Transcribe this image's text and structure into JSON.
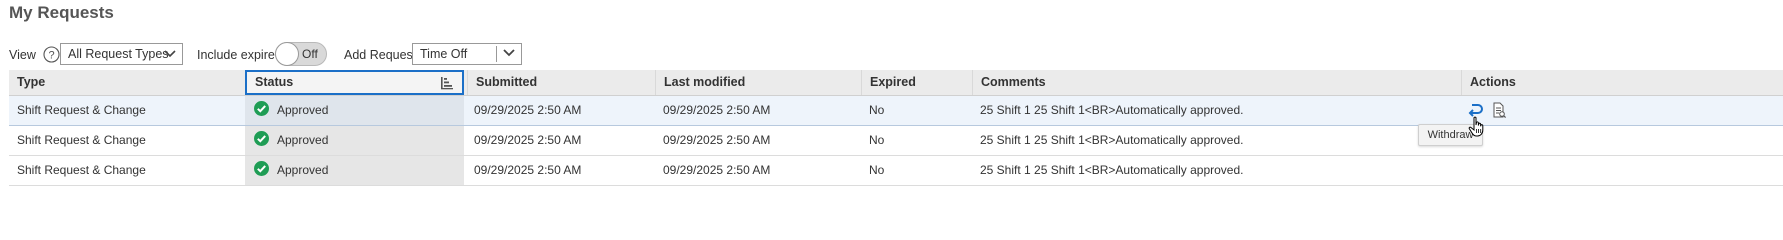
{
  "page": {
    "title": "My Requests"
  },
  "toolbar": {
    "view_label": "View",
    "view_select_value": "All Request Types",
    "include_expired_label": "Include expired",
    "include_expired_toggle": "Off",
    "add_request_label": "Add Request",
    "add_request_value": "Time Off"
  },
  "table": {
    "columns": [
      "Type",
      "Status",
      "Submitted",
      "Last modified",
      "Expired",
      "Comments",
      "Actions"
    ],
    "rows": [
      {
        "type": "Shift Request & Change",
        "status": "Approved",
        "submitted": "09/29/2025 2:50 AM",
        "last_modified": "09/29/2025 2:50 AM",
        "expired": "No",
        "comments": "25 Shift 1 25 Shift 1<BR>Automatically approved."
      },
      {
        "type": "Shift Request & Change",
        "status": "Approved",
        "submitted": "09/29/2025 2:50 AM",
        "last_modified": "09/29/2025 2:50 AM",
        "expired": "No",
        "comments": "25 Shift 1 25 Shift 1<BR>Automatically approved."
      },
      {
        "type": "Shift Request & Change",
        "status": "Approved",
        "submitted": "09/29/2025 2:50 AM",
        "last_modified": "09/29/2025 2:50 AM",
        "expired": "No",
        "comments": "25 Shift 1 25 Shift 1<BR>Automatically approved."
      }
    ]
  },
  "tooltip": {
    "text": "Withdraw"
  },
  "colors": {
    "accent": "#1b6fc7",
    "approved_green": "#1f9d55",
    "selected_row": "#eef4fb"
  },
  "icons": [
    "help-icon",
    "chevron-down-icon",
    "sort-icon",
    "check-circle-icon",
    "withdraw-icon",
    "details-icon",
    "hand-cursor-icon"
  ]
}
